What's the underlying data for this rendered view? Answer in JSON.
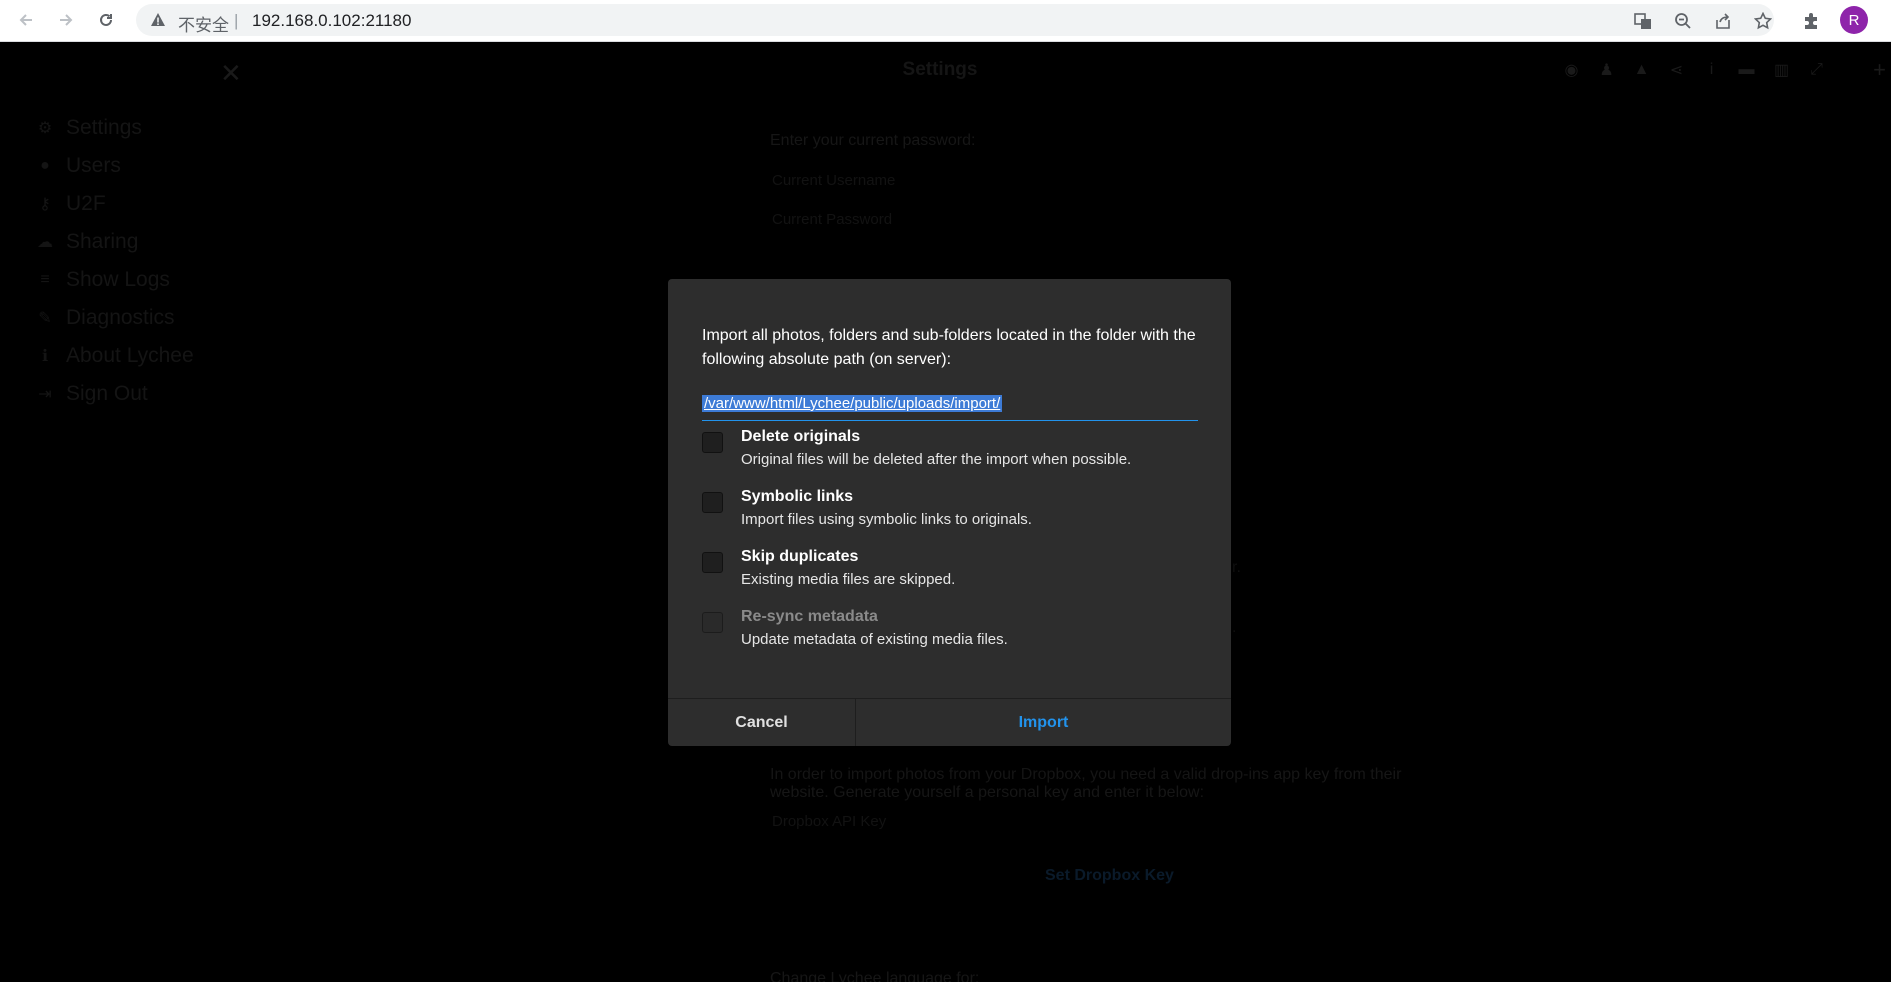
{
  "browser": {
    "insecure_label": "不安全",
    "separator": "|",
    "url": "192.168.0.102:21180",
    "avatar_letter": "R"
  },
  "sidebar": {
    "close_glyph": "✕",
    "items": [
      {
        "label": "Settings",
        "icon": "gear-icon"
      },
      {
        "label": "Users",
        "icon": "user-icon"
      },
      {
        "label": "U2F",
        "icon": "key-icon"
      },
      {
        "label": "Sharing",
        "icon": "cloud-icon"
      },
      {
        "label": "Show Logs",
        "icon": "list-icon"
      },
      {
        "label": "Diagnostics",
        "icon": "wrench-icon"
      },
      {
        "label": "About Lychee",
        "icon": "info-icon"
      },
      {
        "label": "Sign Out",
        "icon": "signout-icon"
      }
    ]
  },
  "header": {
    "title": "Settings"
  },
  "background": {
    "password_prompt": "Enter your current password:",
    "current_username_placeholder": "Current Username",
    "current_password_placeholder": "Current Password",
    "dropbox_text_line1": "In order to import photos from your Dropbox, you need a valid drop-ins app key from their",
    "dropbox_text_line2": "website. Generate yourself a personal key and enter it below:",
    "dropbox_key_placeholder": "Dropbox API Key",
    "set_dropbox_key": "Set Dropbox Key",
    "language_label": "Change Lychee language for:",
    "frag_r": "r.",
    "frag_dot": "."
  },
  "modal": {
    "description": "Import all photos, folders and sub-folders located in the folder with the following absolute path (on server):",
    "path_value": "/var/www/html/Lychee/public/uploads/import/",
    "options": [
      {
        "title": "Delete originals",
        "desc": "Original files will be deleted after the import when possible.",
        "disabled": false
      },
      {
        "title": "Symbolic links",
        "desc": "Import files using symbolic links to originals.",
        "disabled": false
      },
      {
        "title": "Skip duplicates",
        "desc": "Existing media files are skipped.",
        "disabled": false
      },
      {
        "title": "Re-sync metadata",
        "desc": "Update metadata of existing media files.",
        "disabled": true
      }
    ],
    "cancel_label": "Cancel",
    "import_label": "Import"
  }
}
